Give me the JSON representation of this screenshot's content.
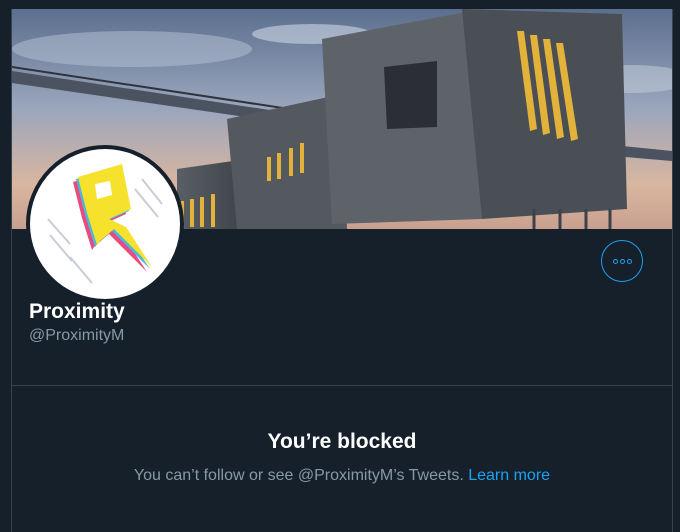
{
  "profile": {
    "name": "Proximity",
    "handle": "@ProximityM"
  },
  "blocked": {
    "title": "You’re blocked",
    "message": "You can’t follow or see @ProximityM’s Tweets.",
    "link": "Learn more"
  },
  "icons": {
    "more": "more-options-icon",
    "avatar": "proximity-logo"
  },
  "colors": {
    "background": "#15202b",
    "accent": "#1da1f2",
    "secondary_text": "#8899a6",
    "border": "#38444d"
  }
}
